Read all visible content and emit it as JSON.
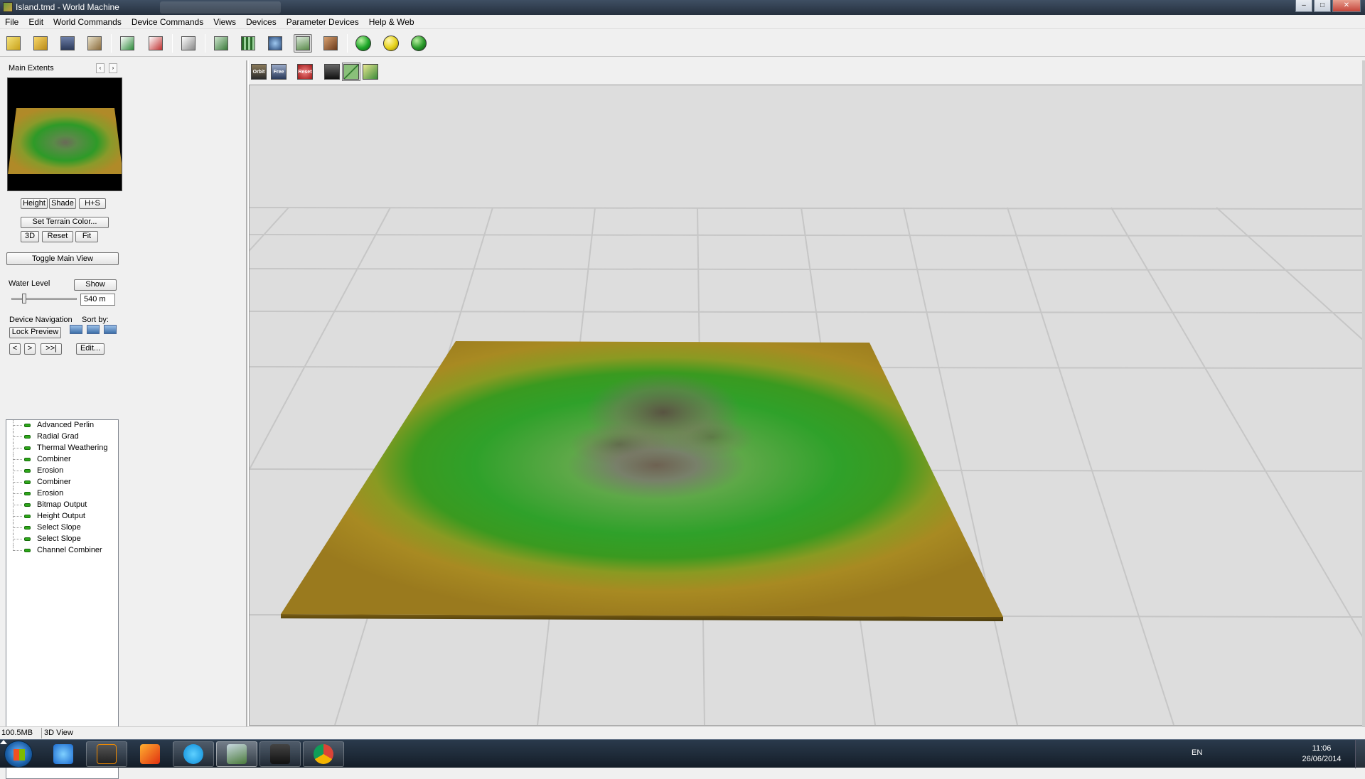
{
  "window": {
    "title": "Island.tmd - World Machine",
    "minimize": "–",
    "maximize": "□",
    "close": "✕"
  },
  "menu": [
    "File",
    "Edit",
    "World Commands",
    "Device Commands",
    "Views",
    "Devices",
    "Parameter Devices",
    "Help & Web"
  ],
  "toolbar": {
    "icons": [
      "new-world-icon",
      "open-icon",
      "save-icon",
      "save-as-icon",
      "build-icon",
      "stop-build-icon",
      "random-seed-icon",
      "device-view-icon",
      "layout-view-icon",
      "explorer-icon",
      "3d-view-icon",
      "world-settings-icon",
      "green-globe-icon",
      "yellow-globe-icon",
      "network-globe-icon"
    ],
    "colors": {
      "green": "#1fa82a",
      "yellow": "#e6d21a"
    }
  },
  "preview": {
    "title": "Main Extents",
    "prev": "‹",
    "next": "›",
    "buttons": {
      "height": "Height",
      "shade": "Shade",
      "hs": "H+S",
      "set_color": "Set Terrain Color...",
      "3d": "3D",
      "reset": "Reset",
      "fit": "Fit"
    }
  },
  "toggle_main_view": "Toggle Main View",
  "water": {
    "label": "Water Level",
    "show": "Show",
    "value": "540 m",
    "slider_fraction": 0.15
  },
  "nav": {
    "label": "Device Navigation",
    "sort_by": "Sort by:",
    "lock_preview": "Lock Preview",
    "back": "<",
    "forward": ">",
    "last": ">>|",
    "edit": "Edit..."
  },
  "devices": [
    "Advanced Perlin",
    "Radial Grad",
    "Thermal Weathering",
    "Combiner",
    "Erosion",
    "Combiner",
    "Erosion",
    "Bitmap Output",
    "Height Output",
    "Select Slope",
    "Select Slope",
    "Channel Combiner"
  ],
  "view_toolbar": {
    "orbit": "Orbit",
    "free": "Free",
    "reset": "Reset"
  },
  "status": {
    "memory": "100.5MB",
    "view": "3D View"
  },
  "taskbar": {
    "apps": [
      "internet-explorer-icon",
      "sublime-text-icon",
      "sketchbook-icon",
      "skype-icon",
      "world-machine-icon",
      "unity-icon",
      "chrome-icon"
    ],
    "lang": "EN",
    "time": "11:06",
    "date": "26/06/2014"
  }
}
